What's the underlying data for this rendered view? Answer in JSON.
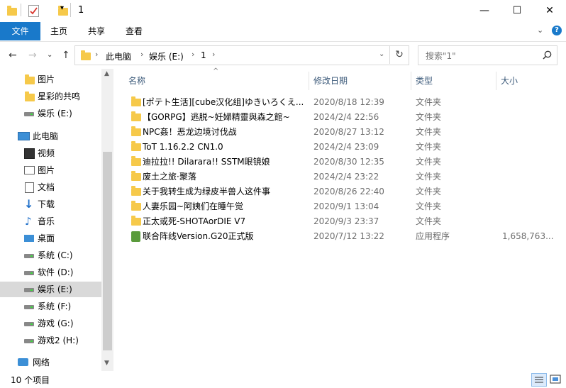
{
  "window": {
    "title": "1"
  },
  "window_controls": {
    "minimize": "—",
    "maximize": "☐",
    "close": "✕"
  },
  "ribbon": {
    "tabs": [
      {
        "label": "文件",
        "active": true
      },
      {
        "label": "主页",
        "active": false
      },
      {
        "label": "共享",
        "active": false
      },
      {
        "label": "查看",
        "active": false
      }
    ]
  },
  "address": {
    "crumbs": [
      "此电脑",
      "娱乐 (E:)",
      "1"
    ],
    "search_placeholder": "搜索\"1\""
  },
  "sidebar": {
    "items": [
      {
        "label": "图片",
        "icon": "folder-icon"
      },
      {
        "label": "星彩的共鸣",
        "icon": "folder-icon"
      },
      {
        "label": "娱乐 (E:)",
        "icon": "drive-icon"
      },
      {
        "label": "此电脑",
        "icon": "computer-icon"
      },
      {
        "label": "视频",
        "icon": "video-icon"
      },
      {
        "label": "图片",
        "icon": "picture-icon"
      },
      {
        "label": "文档",
        "icon": "document-icon"
      },
      {
        "label": "下载",
        "icon": "download-icon"
      },
      {
        "label": "音乐",
        "icon": "music-icon"
      },
      {
        "label": "桌面",
        "icon": "desktop-icon"
      },
      {
        "label": "系统 (C:)",
        "icon": "drive-icon"
      },
      {
        "label": "软件 (D:)",
        "icon": "drive-icon"
      },
      {
        "label": "娱乐 (E:)",
        "icon": "drive-icon",
        "selected": true
      },
      {
        "label": "系统 (F:)",
        "icon": "drive-icon"
      },
      {
        "label": "游戏 (G:)",
        "icon": "drive-icon"
      },
      {
        "label": "游戏2 (H:)",
        "icon": "drive-icon"
      },
      {
        "label": "网络",
        "icon": "network-icon"
      }
    ]
  },
  "columns": {
    "name": "名称",
    "date": "修改日期",
    "type": "类型",
    "size": "大小"
  },
  "files": [
    {
      "name": "[ポテト生活][cube汉化组]ゆきいろくえ...",
      "date": "2020/8/18 12:39",
      "type": "文件夹",
      "size": ""
    },
    {
      "name": "【GORPG】逃脱~妊婦精靈與森之館~",
      "date": "2024/2/4 22:56",
      "type": "文件夹",
      "size": ""
    },
    {
      "name": "NPC姦！恶龙边境讨伐战",
      "date": "2020/8/27 13:12",
      "type": "文件夹",
      "size": ""
    },
    {
      "name": "ToT 1.16.2.2 CN1.0",
      "date": "2024/2/4 23:09",
      "type": "文件夹",
      "size": ""
    },
    {
      "name": "迪拉拉!! Dilarara!! SSTM眼镜娘",
      "date": "2020/8/30 12:35",
      "type": "文件夹",
      "size": ""
    },
    {
      "name": "废土之旅·聚落",
      "date": "2024/2/4 23:22",
      "type": "文件夹",
      "size": ""
    },
    {
      "name": "关于我转生成为绿皮半兽人这件事",
      "date": "2020/8/26 22:40",
      "type": "文件夹",
      "size": ""
    },
    {
      "name": "人妻乐园~阿姨们在睡午觉",
      "date": "2020/9/1 13:04",
      "type": "文件夹",
      "size": ""
    },
    {
      "name": "正太或死-SHOTAorDIE V7",
      "date": "2020/9/3 23:37",
      "type": "文件夹",
      "size": ""
    },
    {
      "name": "联合阵线Version.G20正式版",
      "date": "2020/7/12 13:22",
      "type": "应用程序",
      "size": "1,658,763..."
    }
  ],
  "status": {
    "count": "10 个项目"
  }
}
